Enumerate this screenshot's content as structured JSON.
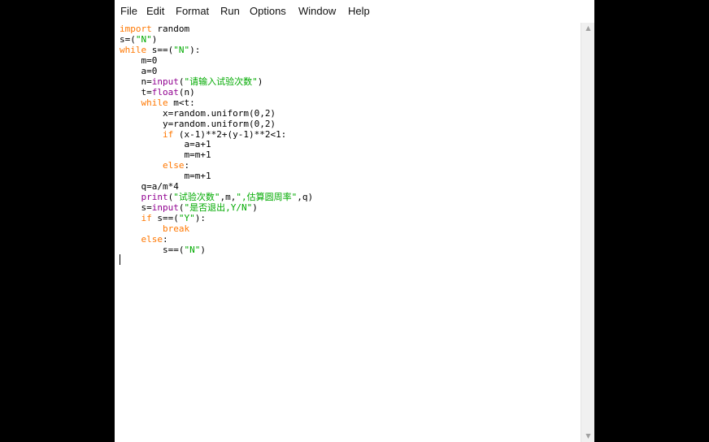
{
  "menu": {
    "items": [
      "File",
      "Edit",
      "Format",
      "Run",
      "Options",
      "Window",
      "Help"
    ]
  },
  "code_lines": [
    {
      "indent": "",
      "parts": [
        {
          "t": "import",
          "c": "kw"
        },
        {
          "t": " random",
          "c": ""
        }
      ]
    },
    {
      "indent": "",
      "parts": [
        {
          "t": "s=(",
          "c": ""
        },
        {
          "t": "\"N\"",
          "c": "str"
        },
        {
          "t": ")",
          "c": ""
        }
      ]
    },
    {
      "indent": "",
      "parts": [
        {
          "t": "while",
          "c": "kw"
        },
        {
          "t": " s==(",
          "c": ""
        },
        {
          "t": "\"N\"",
          "c": "str"
        },
        {
          "t": "):",
          "c": ""
        }
      ]
    },
    {
      "indent": "    ",
      "parts": [
        {
          "t": "m=0",
          "c": ""
        }
      ]
    },
    {
      "indent": "    ",
      "parts": [
        {
          "t": "a=0",
          "c": ""
        }
      ]
    },
    {
      "indent": "    ",
      "parts": [
        {
          "t": "n=",
          "c": ""
        },
        {
          "t": "input",
          "c": "bi"
        },
        {
          "t": "(",
          "c": ""
        },
        {
          "t": "\"请输入试验次数\"",
          "c": "str"
        },
        {
          "t": ")",
          "c": ""
        }
      ]
    },
    {
      "indent": "    ",
      "parts": [
        {
          "t": "t=",
          "c": ""
        },
        {
          "t": "float",
          "c": "bi"
        },
        {
          "t": "(n)",
          "c": ""
        }
      ]
    },
    {
      "indent": "    ",
      "parts": [
        {
          "t": "while",
          "c": "kw"
        },
        {
          "t": " m<t:",
          "c": ""
        }
      ]
    },
    {
      "indent": "        ",
      "parts": [
        {
          "t": "x=random.uniform(0,2)",
          "c": ""
        }
      ]
    },
    {
      "indent": "        ",
      "parts": [
        {
          "t": "y=random.uniform(0,2)",
          "c": ""
        }
      ]
    },
    {
      "indent": "        ",
      "parts": [
        {
          "t": "if",
          "c": "kw"
        },
        {
          "t": " (x-1)**2+(y-1)**2<1:",
          "c": ""
        }
      ]
    },
    {
      "indent": "            ",
      "parts": [
        {
          "t": "a=a+1",
          "c": ""
        }
      ]
    },
    {
      "indent": "            ",
      "parts": [
        {
          "t": "m=m+1",
          "c": ""
        }
      ]
    },
    {
      "indent": "        ",
      "parts": [
        {
          "t": "else",
          "c": "kw"
        },
        {
          "t": ":",
          "c": ""
        }
      ]
    },
    {
      "indent": "            ",
      "parts": [
        {
          "t": "m=m+1",
          "c": ""
        }
      ]
    },
    {
      "indent": "    ",
      "parts": [
        {
          "t": "q=a/m*4",
          "c": ""
        }
      ]
    },
    {
      "indent": "    ",
      "parts": [
        {
          "t": "print",
          "c": "bi"
        },
        {
          "t": "(",
          "c": ""
        },
        {
          "t": "\"试验次数\"",
          "c": "str"
        },
        {
          "t": ",m,",
          "c": ""
        },
        {
          "t": "\",估算圆周率\"",
          "c": "str"
        },
        {
          "t": ",q)",
          "c": ""
        }
      ]
    },
    {
      "indent": "    ",
      "parts": [
        {
          "t": "s=",
          "c": ""
        },
        {
          "t": "input",
          "c": "bi"
        },
        {
          "t": "(",
          "c": ""
        },
        {
          "t": "\"是否退出,Y/N\"",
          "c": "str"
        },
        {
          "t": ")",
          "c": ""
        }
      ]
    },
    {
      "indent": "    ",
      "parts": [
        {
          "t": "if",
          "c": "kw"
        },
        {
          "t": " s==(",
          "c": ""
        },
        {
          "t": "\"Y\"",
          "c": "str"
        },
        {
          "t": "):",
          "c": ""
        }
      ]
    },
    {
      "indent": "        ",
      "parts": [
        {
          "t": "break",
          "c": "kw"
        }
      ]
    },
    {
      "indent": "    ",
      "parts": [
        {
          "t": "else",
          "c": "kw"
        },
        {
          "t": ":",
          "c": ""
        }
      ]
    },
    {
      "indent": "        ",
      "parts": [
        {
          "t": "s==(",
          "c": ""
        },
        {
          "t": "\"N\"",
          "c": "str"
        },
        {
          "t": ")",
          "c": ""
        }
      ]
    }
  ],
  "colors": {
    "keyword": "#ff7700",
    "builtin": "#900090",
    "string": "#00aa00"
  },
  "icons": {
    "scroll_up": "chevron-up-icon",
    "scroll_down": "chevron-down-icon"
  }
}
